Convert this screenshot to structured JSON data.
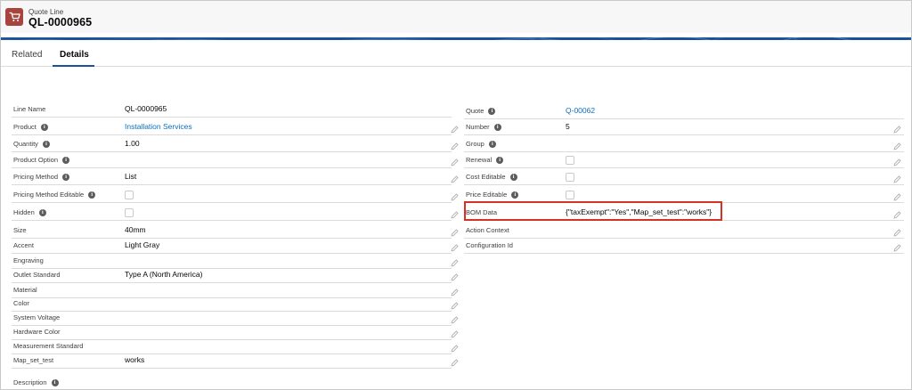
{
  "header": {
    "object_type": "Quote Line",
    "record_name": "QL-0000965",
    "icon": "cart-icon",
    "icon_color": "#a6443d"
  },
  "banner_color": "#1b5297",
  "tabs": [
    {
      "label": "Related",
      "active": false
    },
    {
      "label": "Details",
      "active": true
    }
  ],
  "left_fields": [
    {
      "label": "Line Name",
      "value": "QL-0000965",
      "info": false,
      "editable": false,
      "type": "text"
    },
    {
      "label": "Product",
      "value": "Installation Services",
      "info": true,
      "editable": true,
      "type": "link"
    },
    {
      "label": "Quantity",
      "value": "1.00",
      "info": true,
      "editable": true,
      "type": "text"
    },
    {
      "label": "Product Option",
      "value": "",
      "info": true,
      "editable": true,
      "type": "text"
    },
    {
      "label": "Pricing Method",
      "value": "List",
      "info": true,
      "editable": true,
      "type": "text"
    },
    {
      "label": "Pricing Method Editable",
      "value": "",
      "info": true,
      "editable": true,
      "type": "checkbox"
    },
    {
      "label": "Hidden",
      "value": "",
      "info": true,
      "editable": true,
      "type": "checkbox"
    },
    {
      "label": "Size",
      "value": "40mm",
      "info": false,
      "editable": true,
      "type": "text"
    },
    {
      "label": "Accent",
      "value": "Light Gray",
      "info": false,
      "editable": true,
      "type": "text"
    },
    {
      "label": "Engraving",
      "value": "",
      "info": false,
      "editable": true,
      "type": "text"
    },
    {
      "label": "Outlet Standard",
      "value": "Type A (North America)",
      "info": false,
      "editable": true,
      "type": "text"
    },
    {
      "label": "Material",
      "value": "",
      "info": false,
      "editable": true,
      "type": "text"
    },
    {
      "label": "Color",
      "value": "",
      "info": false,
      "editable": true,
      "type": "text"
    },
    {
      "label": "System Voltage",
      "value": "",
      "info": false,
      "editable": true,
      "type": "text"
    },
    {
      "label": "Hardware Color",
      "value": "",
      "info": false,
      "editable": true,
      "type": "text"
    },
    {
      "label": "Measurement Standard",
      "value": "",
      "info": false,
      "editable": true,
      "type": "text"
    },
    {
      "label": "Map_set_test",
      "value": "works",
      "info": false,
      "editable": true,
      "type": "text"
    }
  ],
  "right_fields": [
    {
      "label": "Quote",
      "value": "Q-00062",
      "info": true,
      "editable": false,
      "type": "link"
    },
    {
      "label": "Number",
      "value": "5",
      "info": true,
      "editable": true,
      "type": "text"
    },
    {
      "label": "Group",
      "value": "",
      "info": true,
      "editable": true,
      "type": "text"
    },
    {
      "label": "Renewal",
      "value": "",
      "info": true,
      "editable": true,
      "type": "checkbox"
    },
    {
      "label": "Cost Editable",
      "value": "",
      "info": true,
      "editable": true,
      "type": "checkbox"
    },
    {
      "label": "Price Editable",
      "value": "",
      "info": true,
      "editable": true,
      "type": "checkbox"
    },
    {
      "label": "BOM Data",
      "value": "{\"taxExempt\":\"Yes\",\"Map_set_test\":\"works\"}",
      "info": false,
      "editable": true,
      "type": "text"
    },
    {
      "label": "Action Context",
      "value": "",
      "info": false,
      "editable": true,
      "type": "text"
    },
    {
      "label": "Configuration Id",
      "value": "",
      "info": false,
      "editable": true,
      "type": "text"
    }
  ],
  "description": {
    "label": "Description",
    "info": true
  },
  "highlight_color": "#d93025"
}
